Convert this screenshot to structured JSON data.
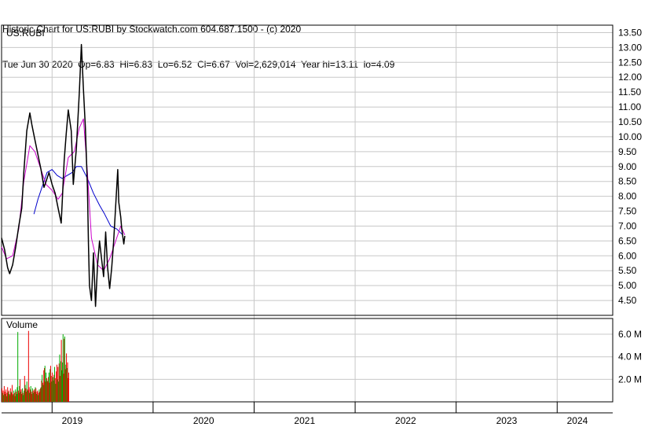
{
  "header": {
    "line1": "Historic Chart for US:RUBI by Stockwatch.com 604.687.1500 - (c) 2020",
    "line2": "Tue Jun 30 2020  Op=6.83  Hi=6.83  Lo=6.52  Cl=6.67  Vol=2,629,014  Year hi=13.11  lo=4.09"
  },
  "chart_data": {
    "type": "line",
    "ticker_label": "US:RUBI",
    "volume_label": "Volume",
    "price_axis": {
      "ylim": [
        4.0,
        13.75
      ],
      "ticks": [
        4.5,
        5.0,
        5.5,
        6.0,
        6.5,
        7.0,
        7.5,
        8.0,
        8.5,
        9.0,
        9.5,
        10.0,
        10.5,
        11.0,
        11.5,
        12.0,
        12.5,
        13.0,
        13.5
      ],
      "tick_labels": [
        "4.50",
        "5.00",
        "5.50",
        "6.00",
        "6.50",
        "7.00",
        "7.50",
        "8.00",
        "8.50",
        "9.00",
        "9.50",
        "10.00",
        "10.50",
        "11.00",
        "11.50",
        "12.00",
        "12.50",
        "13.00",
        "13.50"
      ]
    },
    "volume_axis": {
      "ylim": [
        0,
        7.4
      ],
      "ticks": [
        2,
        4,
        6
      ],
      "tick_labels": [
        "2.0 M",
        "4.0 M",
        "6.0 M"
      ],
      "unit": "M"
    },
    "x_axis": {
      "range": [
        2018.5,
        2024.55
      ],
      "year_boundaries": [
        2019.0,
        2020.0,
        2021.0,
        2022.0,
        2023.0,
        2024.0
      ],
      "labels": [
        "2019",
        "2020",
        "2021",
        "2022",
        "2023",
        "2024"
      ],
      "label_positions": [
        2019.2,
        2020.5,
        2021.5,
        2022.5,
        2023.5,
        2024.2
      ]
    },
    "grid": true,
    "colors": {
      "price": "#000000",
      "ma_short": "#cc00cc",
      "ma_long": "#0000cc",
      "volume_up": "#00aa00",
      "volume_down": "#ee0000",
      "grid": "#c8c8c8"
    },
    "price_series": [
      [
        2018.5,
        6.6
      ],
      [
        2018.53,
        6.2
      ],
      [
        2018.56,
        5.6
      ],
      [
        2018.58,
        5.4
      ],
      [
        2018.61,
        5.7
      ],
      [
        2018.64,
        6.3
      ],
      [
        2018.67,
        7.0
      ],
      [
        2018.7,
        7.6
      ],
      [
        2018.72,
        8.8
      ],
      [
        2018.75,
        10.2
      ],
      [
        2018.78,
        10.8
      ],
      [
        2018.8,
        10.4
      ],
      [
        2018.83,
        9.9
      ],
      [
        2018.86,
        9.4
      ],
      [
        2018.89,
        8.9
      ],
      [
        2018.92,
        8.3
      ],
      [
        2018.94,
        8.5
      ],
      [
        2018.97,
        8.8
      ],
      [
        2019.0,
        8.4
      ],
      [
        2019.03,
        8.1
      ],
      [
        2019.06,
        7.6
      ],
      [
        2019.09,
        7.1
      ],
      [
        2019.1,
        7.8
      ],
      [
        2019.12,
        9.2
      ],
      [
        2019.14,
        10.1
      ],
      [
        2019.16,
        10.9
      ],
      [
        2019.19,
        10.2
      ],
      [
        2019.21,
        8.4
      ],
      [
        2019.24,
        9.6
      ],
      [
        2019.27,
        11.5
      ],
      [
        2019.29,
        13.1
      ],
      [
        2019.31,
        11.6
      ],
      [
        2019.33,
        10.3
      ],
      [
        2019.35,
        8.3
      ],
      [
        2019.36,
        6.4
      ],
      [
        2019.37,
        5.0
      ],
      [
        2019.39,
        4.5
      ],
      [
        2019.41,
        6.1
      ],
      [
        2019.43,
        4.3
      ],
      [
        2019.45,
        5.7
      ],
      [
        2019.47,
        6.5
      ],
      [
        2019.49,
        5.9
      ],
      [
        2019.51,
        5.3
      ],
      [
        2019.53,
        6.8
      ],
      [
        2019.55,
        5.6
      ],
      [
        2019.57,
        4.9
      ],
      [
        2019.59,
        5.6
      ],
      [
        2019.61,
        6.5
      ],
      [
        2019.63,
        7.7
      ],
      [
        2019.65,
        8.9
      ],
      [
        2019.66,
        7.8
      ],
      [
        2019.68,
        7.3
      ],
      [
        2019.69,
        6.9
      ],
      [
        2019.71,
        6.4
      ],
      [
        2019.72,
        6.67
      ]
    ],
    "ma_short_series": [
      [
        2018.5,
        6.3
      ],
      [
        2018.55,
        5.9
      ],
      [
        2018.61,
        6.0
      ],
      [
        2018.67,
        6.9
      ],
      [
        2018.72,
        8.5
      ],
      [
        2018.78,
        9.7
      ],
      [
        2018.83,
        9.5
      ],
      [
        2018.89,
        8.9
      ],
      [
        2018.94,
        8.4
      ],
      [
        2019.0,
        8.2
      ],
      [
        2019.06,
        7.9
      ],
      [
        2019.1,
        8.1
      ],
      [
        2019.16,
        9.3
      ],
      [
        2019.22,
        9.5
      ],
      [
        2019.27,
        10.3
      ],
      [
        2019.31,
        10.6
      ],
      [
        2019.35,
        8.8
      ],
      [
        2019.39,
        6.6
      ],
      [
        2019.45,
        5.7
      ],
      [
        2019.51,
        5.5
      ],
      [
        2019.57,
        5.9
      ],
      [
        2019.63,
        6.5
      ],
      [
        2019.68,
        7.0
      ],
      [
        2019.72,
        6.7
      ]
    ],
    "ma_long_series": [
      [
        2018.82,
        7.4
      ],
      [
        2018.86,
        7.9
      ],
      [
        2018.9,
        8.3
      ],
      [
        2018.95,
        8.8
      ],
      [
        2019.0,
        8.9
      ],
      [
        2019.05,
        8.7
      ],
      [
        2019.1,
        8.6
      ],
      [
        2019.15,
        8.7
      ],
      [
        2019.2,
        8.8
      ],
      [
        2019.24,
        9.0
      ],
      [
        2019.29,
        9.0
      ],
      [
        2019.35,
        8.6
      ],
      [
        2019.41,
        8.1
      ],
      [
        2019.47,
        7.7
      ],
      [
        2019.52,
        7.4
      ],
      [
        2019.58,
        7.0
      ],
      [
        2019.64,
        6.9
      ],
      [
        2019.7,
        6.7
      ]
    ],
    "volume_series": {
      "x_start": 2018.5,
      "x_step": 0.0056,
      "values": [
        1.2,
        0.8,
        1.0,
        0.6,
        1.4,
        0.9,
        0.7,
        1.1,
        0.5,
        0.8,
        1.3,
        0.9,
        1.0,
        0.7,
        0.6,
        1.2,
        0.9,
        0.8,
        1.5,
        0.6,
        0.7,
        1.0,
        0.8,
        0.5,
        1.1,
        0.9,
        0.7,
        1.3,
        6.2,
        1.0,
        0.8,
        1.4,
        2.0,
        0.9,
        1.1,
        0.7,
        1.2,
        0.8,
        0.6,
        1.0,
        2.3,
        1.5,
        1.2,
        0.9,
        1.8,
        1.1,
        1.0,
        6.3,
        1.3,
        0.8,
        1.1,
        1.4,
        0.9,
        0.7,
        1.2,
        1.0,
        0.8,
        1.1,
        0.9,
        1.3,
        1.2,
        0.7,
        0.9,
        1.0,
        0.6,
        0.8,
        1.1,
        0.9,
        1.2,
        1.3,
        1.9,
        2.4,
        1.7,
        1.5,
        2.8,
        3.0,
        3.2,
        1.8,
        2.6,
        2.1,
        1.9,
        1.8,
        2.2,
        2.6,
        1.7,
        2.9,
        3.2,
        2.3,
        1.8,
        2.6,
        2.2,
        1.9,
        2.4,
        3.1,
        2.1,
        1.6,
        2.7,
        3.3,
        2.0,
        3.1,
        1.8,
        3.4,
        4.2,
        2.3,
        3.6,
        5.5,
        2.8,
        3.5,
        6.0,
        2.5,
        5.6,
        5.8,
        2.9,
        3.3,
        4.3,
        3.0,
        3.5,
        2.1,
        2.6
      ],
      "colors": "rgrgrrgrgrrgrgrrgrrgrgrrgrgggrrgrgrrgrggrgrrgrgrrgrgrrgrgrrgrgrrgrgrrgrgrgrrgrgrgrrgrgrrgrggrgrgrrgrgrgrgrgggrrgrgrgr"
    }
  }
}
